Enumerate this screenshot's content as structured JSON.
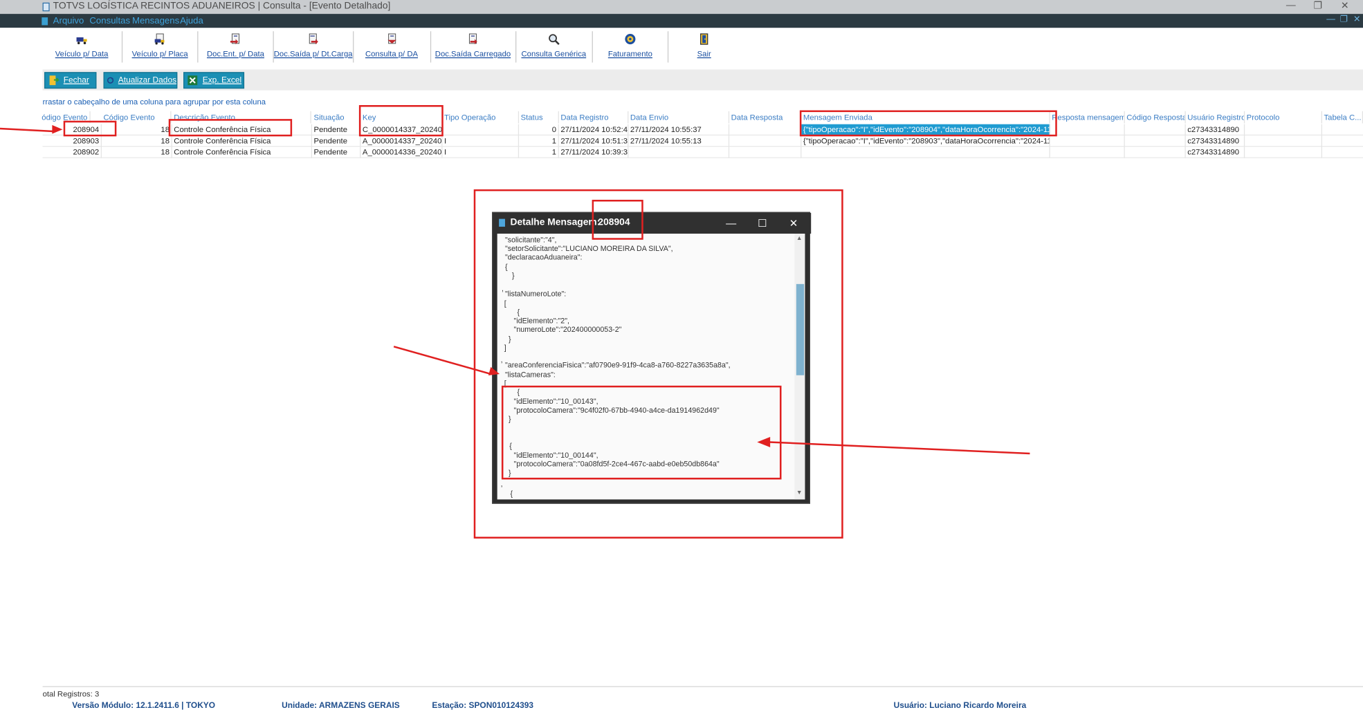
{
  "window": {
    "title": "TOTVS LOGÍSTICA RECINTOS ADUANEIROS | Consulta - [Evento Detalhado]"
  },
  "menu": {
    "items": [
      "Arquivo",
      "Consultas",
      "Mensagens",
      "Ajuda"
    ]
  },
  "toolbar": {
    "buttons": [
      {
        "label": "Veículo p/ Data",
        "icon": "truck-calendar-icon"
      },
      {
        "label": "Veículo p/ Placa",
        "icon": "truck-plate-icon"
      },
      {
        "label": "Doc.Ent. p/ Data",
        "icon": "document-entry-icon"
      },
      {
        "label": "Doc.Saída p/ Dt.Carga",
        "icon": "document-exit-icon"
      },
      {
        "label": "Consulta p/ DA",
        "icon": "document-search-icon"
      },
      {
        "label": "Doc.Saída Carregado",
        "icon": "document-loaded-icon"
      },
      {
        "label": "Consulta Genérica",
        "icon": "magnifier-icon"
      },
      {
        "label": "Faturamento",
        "icon": "billing-icon"
      },
      {
        "label": "Sair",
        "icon": "exit-door-icon"
      }
    ]
  },
  "actions": {
    "close": "Fechar",
    "refresh": "Atualizar Dados",
    "export": "Exp. Excel"
  },
  "grid": {
    "group_hint": "rrastar o cabeçalho de uma coluna para agrupar por esta coluna",
    "columns": [
      "ódigo Evento",
      "Código Evento",
      "Descrição Evento",
      "Situação",
      "Key",
      "Tipo Operação",
      "Status",
      "Data Registro",
      "Data Envio",
      "Data Resposta",
      "Mensagem Enviada",
      "Resposta mensagem",
      "Código Resposta",
      "Usuário Registro",
      "Protocolo",
      "Tabela C..."
    ],
    "rows": [
      {
        "id": "208904",
        "code": "18",
        "description": "Controle Conferência Física",
        "situation": "Pendente",
        "key": "C_0000014337_20240",
        "operation_type": "",
        "status": "0",
        "registered": "27/11/2024 10:52:4",
        "sent": "27/11/2024 10:55:37",
        "response_date": "",
        "message": "{\"tipoOperacao\":\"I\",\"idEvento\":\"208904\",\"dataHoraOcorrencia\":\"2024-11-",
        "reply": "",
        "reply_code": "",
        "user": "c27343314890",
        "protocol": ""
      },
      {
        "id": "208903",
        "code": "18",
        "description": "Controle Conferência Física",
        "situation": "Pendente",
        "key": "A_0000014337_20240",
        "operation_type": "I",
        "status": "1",
        "registered": "27/11/2024 10:51:3",
        "sent": "27/11/2024 10:55:13",
        "response_date": "",
        "message": "{\"tipoOperacao\":\"I\",\"idEvento\":\"208903\",\"dataHoraOcorrencia\":\"2024-11-",
        "reply": "",
        "reply_code": "",
        "user": "c27343314890",
        "protocol": ""
      },
      {
        "id": "208902",
        "code": "18",
        "description": "Controle Conferência Física",
        "situation": "Pendente",
        "key": "A_0000014336_20240",
        "operation_type": "I",
        "status": "1",
        "registered": "27/11/2024 10:39:3",
        "sent": "",
        "response_date": "",
        "message": "",
        "reply": "",
        "reply_code": "",
        "user": "c27343314890",
        "protocol": ""
      }
    ]
  },
  "dialog": {
    "title": "Detalhe Mensagem:",
    "event_id": "208904",
    "lines": [
      "\"solicitante\":\"4\",",
      "\"setorSolicitante\":\"LUCIANO MOREIRA DA SILVA\",",
      "\"declaracaoAduaneira\":",
      "{",
      "}",
      ",",
      "\"listaNumeroLote\":",
      "[",
      "{",
      "\"idElemento\":\"2\",",
      "\"numeroLote\":\"202400000053-2\"",
      "}",
      "]",
      ",",
      "\"areaConferenciaFisica\":\"af0790e9-91f9-4ca8-a760-8227a3635a8a\",",
      "\"listaCameras\":",
      "[",
      "{",
      "\"idElemento\":\"10_00143\",",
      "\"protocoloCamera\":\"9c4f02f0-67bb-4940-a4ce-da1914962d49\"",
      "}",
      "{",
      "\"idElemento\":\"10_00144\",",
      "\"protocoloCamera\":\"0a08fd5f-2ce4-467c-aabd-e0eb50db864a\"",
      "}",
      ",",
      "{"
    ]
  },
  "status": {
    "total": "otal Registros:  3",
    "module": "Versão Módulo:  12.1.2411.6  |  TOKYO",
    "unit": "Unidade: ARMAZENS GERAIS",
    "station": "Estação: SPON010124393",
    "user": "Usuário: Luciano Ricardo Moreira"
  },
  "colors": {
    "annotation_red": "#e02020",
    "selection_blue": "#1f9bd1",
    "menubar_dark": "#2b3a42",
    "action_button_teal": "#1b8fb4"
  }
}
